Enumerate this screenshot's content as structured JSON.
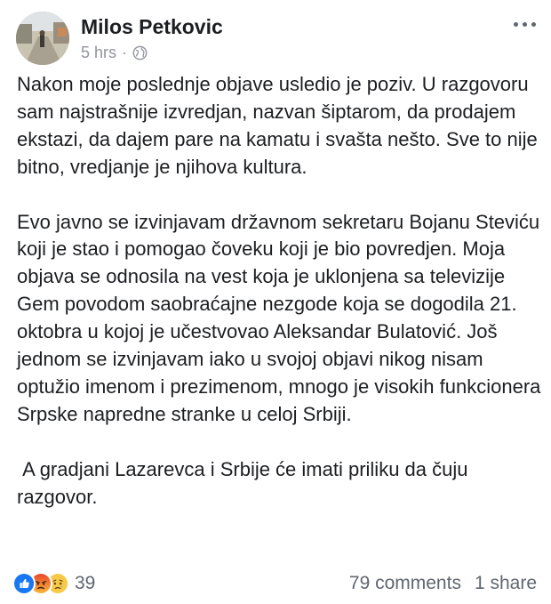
{
  "post": {
    "author": "Milos Petkovic",
    "time": "5 hrs",
    "separator": "·",
    "privacy_icon": "globe-icon",
    "paragraphs": [
      "Nakon moje poslednje objave usledio je poziv. U razgovoru sam najstrašnije izvredjan, nazvan šiptarom, da prodajem ekstazi, da dajem pare na kamatu i svašta nešto. Sve to nije bitno, vredjanje je njihova kultura.",
      "Evo javno se izvinjavam državnom sekretaru Bojanu Steviću koji je stao i pomogao čoveku koji je bio povredjen. Moja objava se odnosila na vest koja je uklonjena sa televizije Gem povodom saobraćajne nezgode koja se dogodila 21. oktobra u kojoj je učestvovao Aleksandar Bulatović. Još jednom se izvinjavam iako u svojoj objavi nikog nisam optužio imenom i prezimenom, mnogo je visokih funkcionera Srpske napredne stranke u celoj Srbiji.",
      " A gradjani Lazarevca i Srbije će imati priliku da čuju razgovor."
    ]
  },
  "footer": {
    "reactions": [
      "like-icon",
      "angry-icon",
      "sad-icon"
    ],
    "reaction_count": "39",
    "comments": "79 comments",
    "shares": "1 share"
  },
  "colors": {
    "like": "#1877f2",
    "angry": "#f0582a",
    "sad": "#f7c948",
    "meta": "#90949c"
  }
}
